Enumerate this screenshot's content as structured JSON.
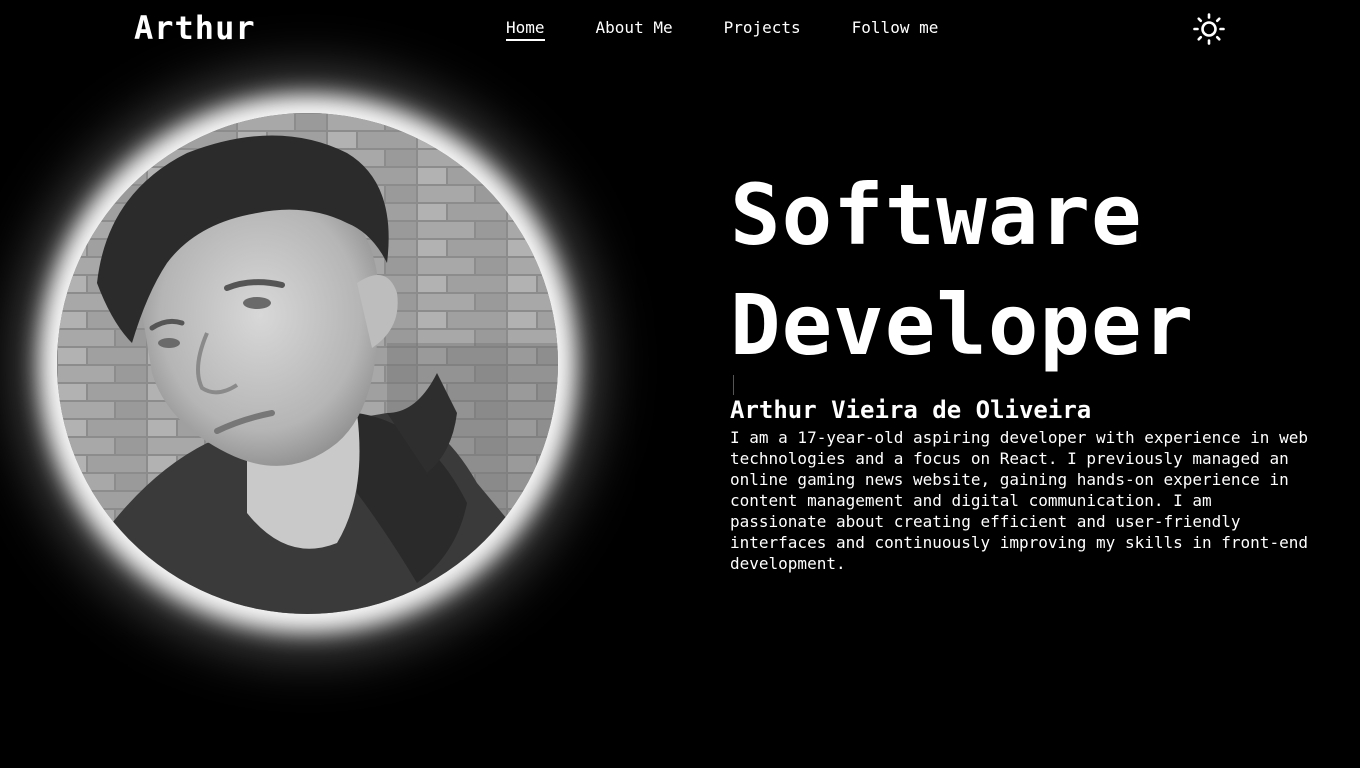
{
  "header": {
    "logo": "Arthur",
    "nav": [
      {
        "label": "Home",
        "active": true
      },
      {
        "label": "About Me",
        "active": false
      },
      {
        "label": "Projects",
        "active": false
      },
      {
        "label": "Follow me",
        "active": false
      }
    ],
    "theme_toggle_icon": "sun-icon"
  },
  "hero": {
    "headline_line1": "Software",
    "headline_line2": "Developer",
    "name": "Arthur Vieira de Oliveira",
    "bio": "I am a 17-year-old aspiring developer with experience in web technologies and a focus on React. I previously managed an online gaming news website, gaining hands-on experience in content management and digital communication. I am passionate about creating efficient and user-friendly interfaces and continuously improving my skills in front-end development.",
    "photo": "profile-photo"
  },
  "colors": {
    "background": "#000000",
    "text": "#ffffff",
    "glow": "#ffffff"
  }
}
